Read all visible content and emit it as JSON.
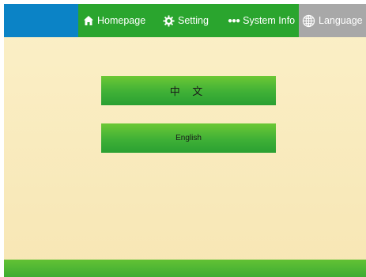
{
  "nav": {
    "home_label": "Homepage",
    "setting_label": "Setting",
    "sysinfo_label": "System Info",
    "language_label": "Language"
  },
  "language_options": {
    "chinese": "中 文",
    "english": "English"
  },
  "colors": {
    "nav_bar": "#2aa52e",
    "logo_block": "#0b83c6",
    "active_tab": "#a8a8a8",
    "button_green": "#3fb036",
    "background": "#f9ecc2"
  },
  "icons": {
    "home": "home-icon",
    "setting": "gear-icon",
    "sysinfo": "dots-icon",
    "language": "globe-icon"
  }
}
